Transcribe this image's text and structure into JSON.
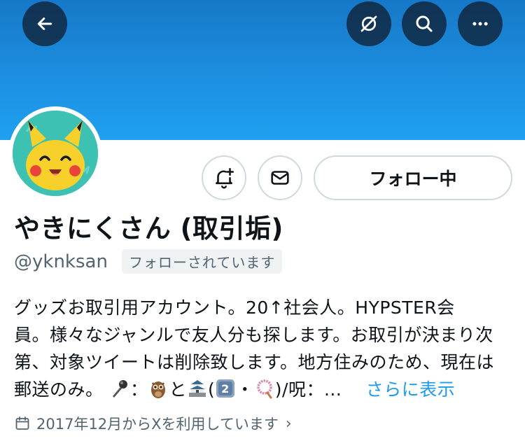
{
  "header": {
    "back_icon": "arrow-left-icon",
    "actions": [
      "circle-slash-icon",
      "search-icon",
      "more-dots-icon"
    ],
    "banner_color": "#1d8fe0"
  },
  "profile": {
    "avatar_icon": "pikachu-face-icon",
    "name": "やきにくさん (取引垢)",
    "handle": "@yknksan",
    "follows_you": "フォローされています",
    "buttons": {
      "notifications_icon": "bell-plus-icon",
      "message_icon": "envelope-icon",
      "follow_label": "フォロー中"
    },
    "bio": {
      "line1": "グッズお取引用アカウント。20↑社会人。HYPSTER会",
      "line2": "員。様々なジャンルで友人分も探します。お取引が決まり次",
      "line3": "第、対象ツイートは削除致します。地方住みのため、現在は",
      "line4_a": "郵送のみ。",
      "line4_b": "：",
      "line4_c": "と",
      "line4_d": "(",
      "line4_e": "・",
      "line4_f": ")/呪：...",
      "more": "さらに表示",
      "emojis": [
        "microphone",
        "owl",
        "japanese-castle",
        "keycap-2",
        "prayer-beads"
      ]
    },
    "joined": "2017年12月からXを利用しています",
    "accent_color": "#1d9bf0"
  }
}
